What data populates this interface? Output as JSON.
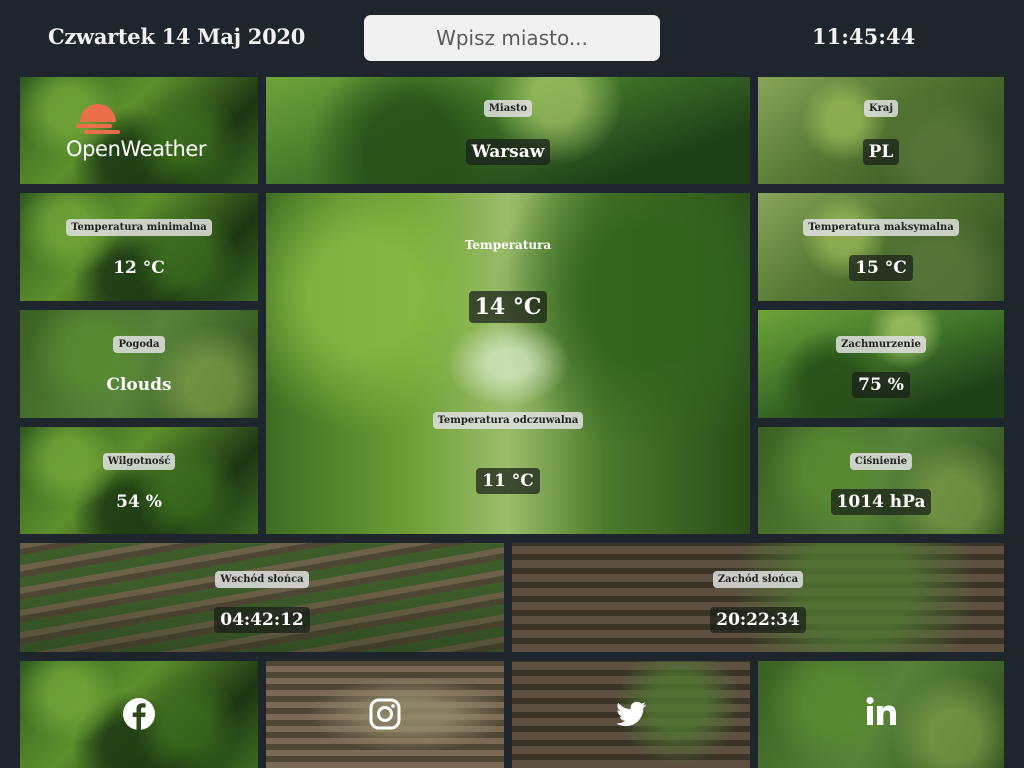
{
  "header": {
    "date": "Czwartek 14 Maj 2020",
    "search_placeholder": "Wpisz miasto...",
    "time": "11:45:44"
  },
  "logo": {
    "text": "OpenWeather",
    "color": "#eb6e4b"
  },
  "tiles": {
    "city": {
      "label": "Miasto",
      "value": "Warsaw"
    },
    "country": {
      "label": "Kraj",
      "value": "PL"
    },
    "temp_min": {
      "label": "Temperatura minimalna",
      "value": "12 °C"
    },
    "temp": {
      "label": "Temperatura",
      "value": "14 °C"
    },
    "temp_max": {
      "label": "Temperatura maksymalna",
      "value": "15 °C"
    },
    "weather": {
      "label": "Pogoda",
      "value": "Clouds"
    },
    "feels_like": {
      "label": "Temperatura odczuwalna",
      "value": "11 °C"
    },
    "clouds": {
      "label": "Zachmurzenie",
      "value": "75 %"
    },
    "humidity": {
      "label": "Wilgotność",
      "value": "54 %"
    },
    "pressure": {
      "label": "Ciśnienie",
      "value": "1014 hPa"
    },
    "sunrise": {
      "label": "Wschód słońca",
      "value": "04:42:12"
    },
    "sunset": {
      "label": "Zachód słońca",
      "value": "20:22:34"
    }
  },
  "social": [
    "facebook-icon",
    "instagram-icon",
    "twitter-icon",
    "linkedin-icon"
  ]
}
